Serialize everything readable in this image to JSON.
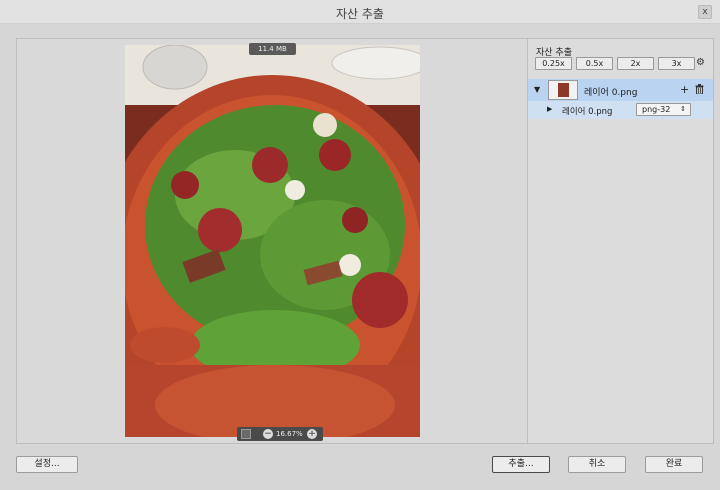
{
  "window": {
    "title": "자산 추출",
    "close_label": "x"
  },
  "preview": {
    "file_size": "11.4 MB",
    "zoom_level": "16.67%",
    "zoom_out_label": "−",
    "zoom_in_label": "+",
    "image_subject": "pizza with greens, tomatoes and cheese"
  },
  "sidebar": {
    "title": "자산 추출",
    "scales": [
      "0.25x",
      "0.5x",
      "2x",
      "3x"
    ],
    "settings_icon": "gear-icon",
    "asset": {
      "expand_glyph": "▼",
      "name": "레이어 0.png",
      "add_label": "+",
      "delete_glyph": "🗑"
    },
    "sub_asset": {
      "expand_glyph": "▶",
      "name": "레이어 0.png",
      "format": "png-32",
      "format_caret": "⇕"
    }
  },
  "footer": {
    "settings_button": "설정...",
    "extract_button": "추출...",
    "cancel_button": "취소",
    "done_button": "완료"
  },
  "colors": {
    "selected_row": "#b9d3f0",
    "sub_row": "#cfe0f2",
    "background": "#d6d6d6"
  }
}
